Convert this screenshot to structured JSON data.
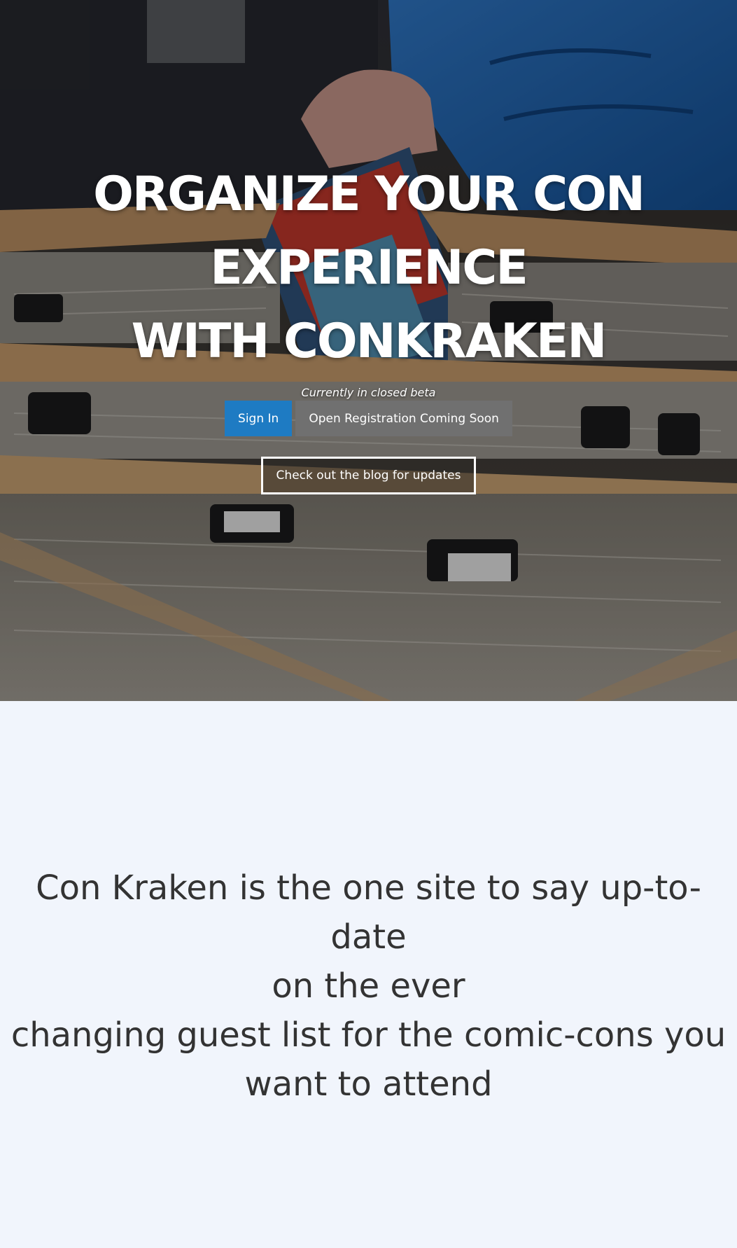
{
  "hero": {
    "headline_line1": "ORGANIZE YOUR CON",
    "headline_line2": "EXPERIENCE",
    "headline_line3": "WITH CONKRAKEN",
    "beta_note": "Currently in closed beta",
    "signin_label": "Sign In",
    "register_label": "Open Registration Coming Soon",
    "blog_label": "Check out the blog for updates",
    "background_image": "comic-book-bins-photo",
    "accent_color": "#1e7bc3"
  },
  "about": {
    "line1": "Con Kraken is the one site to say up-to-date",
    "line2": "on the ever",
    "line3": "changing guest list for the comic-cons you",
    "line4": "want to attend"
  }
}
